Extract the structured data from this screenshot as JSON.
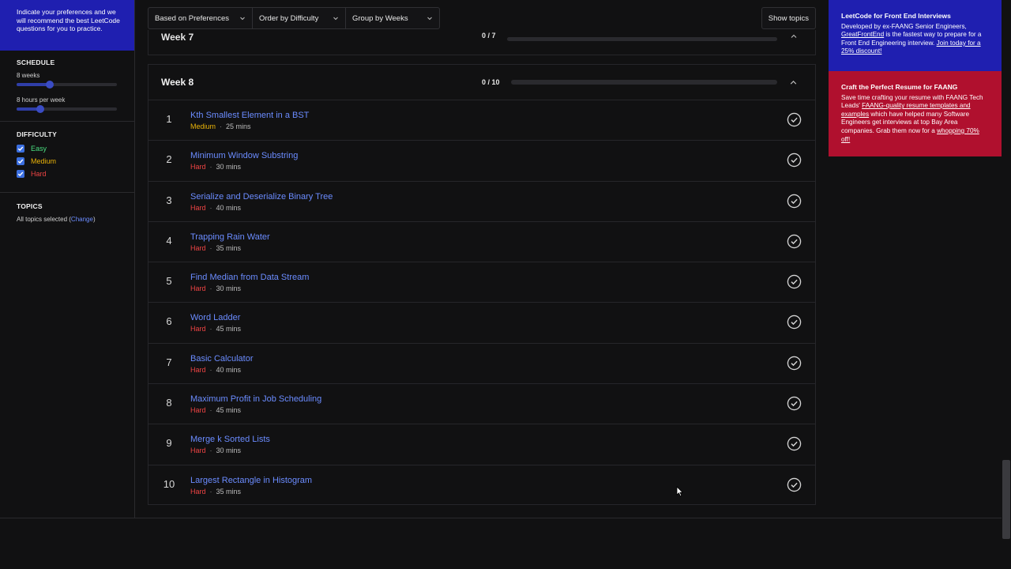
{
  "sidebar": {
    "intro": "Indicate your preferences and we will recommend the best LeetCode questions for you to practice.",
    "schedule": {
      "title": "SCHEDULE",
      "weeks_label": "8 weeks",
      "hours_label": "8 hours per week"
    },
    "difficulty": {
      "title": "DIFFICULTY",
      "items": [
        {
          "label": "Easy",
          "color": "#4ade80"
        },
        {
          "label": "Medium",
          "color": "#eab308"
        },
        {
          "label": "Hard",
          "color": "#ef4444"
        }
      ]
    },
    "topics": {
      "title": "TOPICS",
      "text_before": "All topics selected (",
      "change_link": "Change",
      "text_after": ")"
    }
  },
  "toolbar": {
    "filter1": "Based on Preferences",
    "filter2": "Order by Difficulty",
    "filter3": "Group by Weeks",
    "show_topics": "Show topics"
  },
  "week7": {
    "title": "Week 7",
    "count": "0 / 7"
  },
  "week8": {
    "title": "Week 8",
    "count": "0 / 10",
    "questions": [
      {
        "num": "1",
        "title": "Kth Smallest Element in a BST",
        "difficulty": "Medium",
        "duration": "25 mins"
      },
      {
        "num": "2",
        "title": "Minimum Window Substring",
        "difficulty": "Hard",
        "duration": "30 mins"
      },
      {
        "num": "3",
        "title": "Serialize and Deserialize Binary Tree",
        "difficulty": "Hard",
        "duration": "40 mins"
      },
      {
        "num": "4",
        "title": "Trapping Rain Water",
        "difficulty": "Hard",
        "duration": "35 mins"
      },
      {
        "num": "5",
        "title": "Find Median from Data Stream",
        "difficulty": "Hard",
        "duration": "30 mins"
      },
      {
        "num": "6",
        "title": "Word Ladder",
        "difficulty": "Hard",
        "duration": "45 mins"
      },
      {
        "num": "7",
        "title": "Basic Calculator",
        "difficulty": "Hard",
        "duration": "40 mins"
      },
      {
        "num": "8",
        "title": "Maximum Profit in Job Scheduling",
        "difficulty": "Hard",
        "duration": "45 mins"
      },
      {
        "num": "9",
        "title": "Merge k Sorted Lists",
        "difficulty": "Hard",
        "duration": "30 mins"
      },
      {
        "num": "10",
        "title": "Largest Rectangle in Histogram",
        "difficulty": "Hard",
        "duration": "35 mins"
      }
    ]
  },
  "ads": {
    "ad1": {
      "title": "LeetCode for Front End Interviews",
      "text1": "Developed by ex-FAANG Senior Engineers, ",
      "link1": "GreatFrontEnd",
      "text2": " is the fastest way to prepare for a Front End Engineering interview. ",
      "link2": "Join today for a 25% discount!"
    },
    "ad2": {
      "title": "Craft the Perfect Resume for FAANG",
      "text1": "Save time crafting your resume with FAANG Tech Leads' ",
      "link1": "FAANG-quality resume templates and examples",
      "text2": " which have helped many Software Engineers get interviews at top Bay Area companies. Grab them now for a ",
      "link2": "whopping 70% off!"
    }
  },
  "colors": {
    "accent_blue": "#1f1fb0",
    "ad_red": "#b0102e",
    "link": "#6b8cff",
    "hard": "#ef4444",
    "medium": "#eab308",
    "easy": "#4ade80"
  }
}
